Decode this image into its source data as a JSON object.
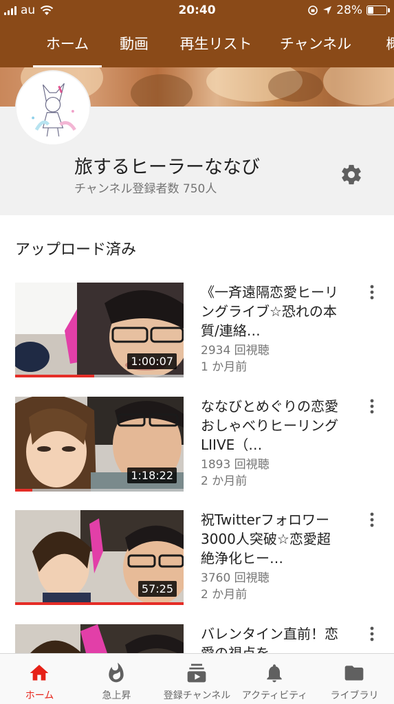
{
  "status_bar": {
    "carrier": "au",
    "time": "20:40",
    "battery": "28%",
    "battery_level": 0.28
  },
  "tabs": [
    {
      "label": "ホーム",
      "active": true
    },
    {
      "label": "動画",
      "active": false
    },
    {
      "label": "再生リスト",
      "active": false
    },
    {
      "label": "チャンネル",
      "active": false
    },
    {
      "label": "概",
      "active": false
    }
  ],
  "channel": {
    "name": "旅するヒーラーななび",
    "subscribers": "チャンネル登録者数 750人"
  },
  "uploads": {
    "title": "アップロード済み",
    "videos": [
      {
        "title": "《一斉遠隔恋愛ヒーリングライブ☆恐れの本質/連絡…",
        "views": "2934 回視聴",
        "age": "1 か月前",
        "duration": "1:00:07",
        "watched": 0.47
      },
      {
        "title": "ななびとめぐりの恋愛おしゃべりヒーリングLIIVE（…",
        "views": "1893 回視聴",
        "age": "2 か月前",
        "duration": "1:18:22",
        "watched": 0.1
      },
      {
        "title": "祝Twitterフォロワー3000人突破☆恋愛超絶浄化ヒー…",
        "views": "3760 回視聴",
        "age": "2 か月前",
        "duration": "57:25",
        "watched": 1.0
      },
      {
        "title": "バレンタイン直前！恋愛の視点を",
        "views": "",
        "age": "",
        "duration": "",
        "watched": 0
      }
    ]
  },
  "bottom_nav": [
    {
      "label": "ホーム",
      "icon": "home-icon",
      "active": true
    },
    {
      "label": "急上昇",
      "icon": "flame-icon",
      "active": false
    },
    {
      "label": "登録チャンネル",
      "icon": "subscriptions-icon",
      "active": false
    },
    {
      "label": "アクティビティ",
      "icon": "bell-icon",
      "active": false
    },
    {
      "label": "ライブラリ",
      "icon": "folder-icon",
      "active": false
    }
  ],
  "colors": {
    "header_brown": "#8a4a18",
    "active_red": "#e62117",
    "progress_red": "#e52d27"
  }
}
